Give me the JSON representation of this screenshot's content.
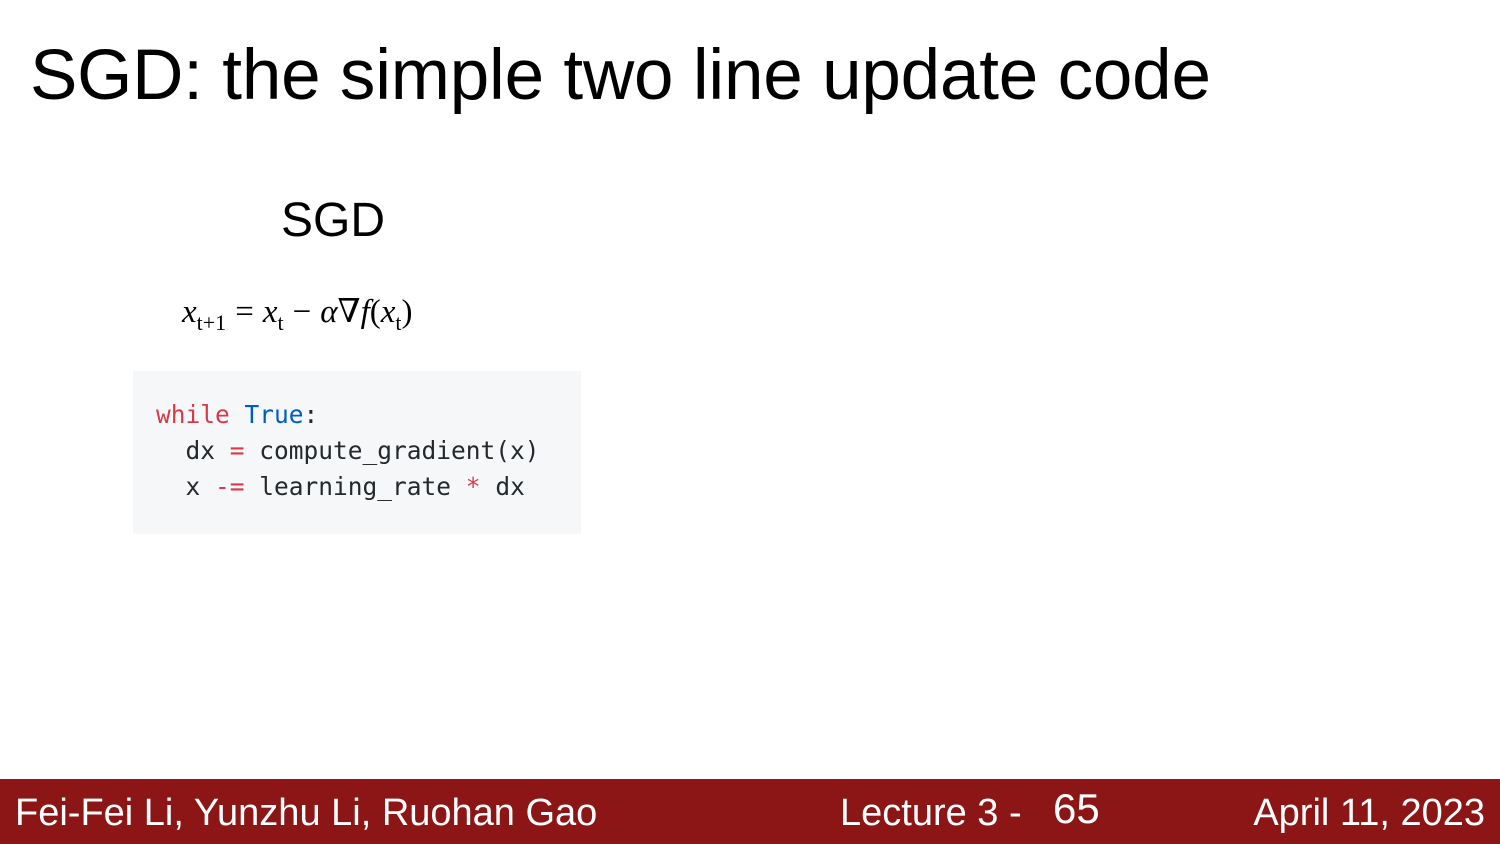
{
  "slide": {
    "title": "SGD: the simple two line update code",
    "subtitle": "SGD"
  },
  "formula": {
    "lhs_var": "x",
    "lhs_sub": "t+1",
    "eq": "=",
    "rhs_var": "x",
    "rhs_sub": "t",
    "minus": "−",
    "alpha": "α",
    "nabla": "∇",
    "f": "f",
    "lparen": "(",
    "arg_var": "x",
    "arg_sub": "t",
    "rparen": ")"
  },
  "code": {
    "line1": {
      "kw": "while",
      "sp": " ",
      "builtin": "True",
      "rest": ":"
    },
    "line2": {
      "indent": "  dx ",
      "op": "=",
      "rest": " compute_gradient(x)"
    },
    "line3": {
      "indent": "  x ",
      "op": "-=",
      "mid": " learning_rate ",
      "op2": "*",
      "rest": " dx"
    }
  },
  "footer": {
    "authors": "Fei-Fei Li, Yunzhu Li, Ruohan Gao",
    "lecture": "Lecture 3 -",
    "page": "65",
    "date": "April 11, 2023",
    "background_color": "#8c1515"
  }
}
